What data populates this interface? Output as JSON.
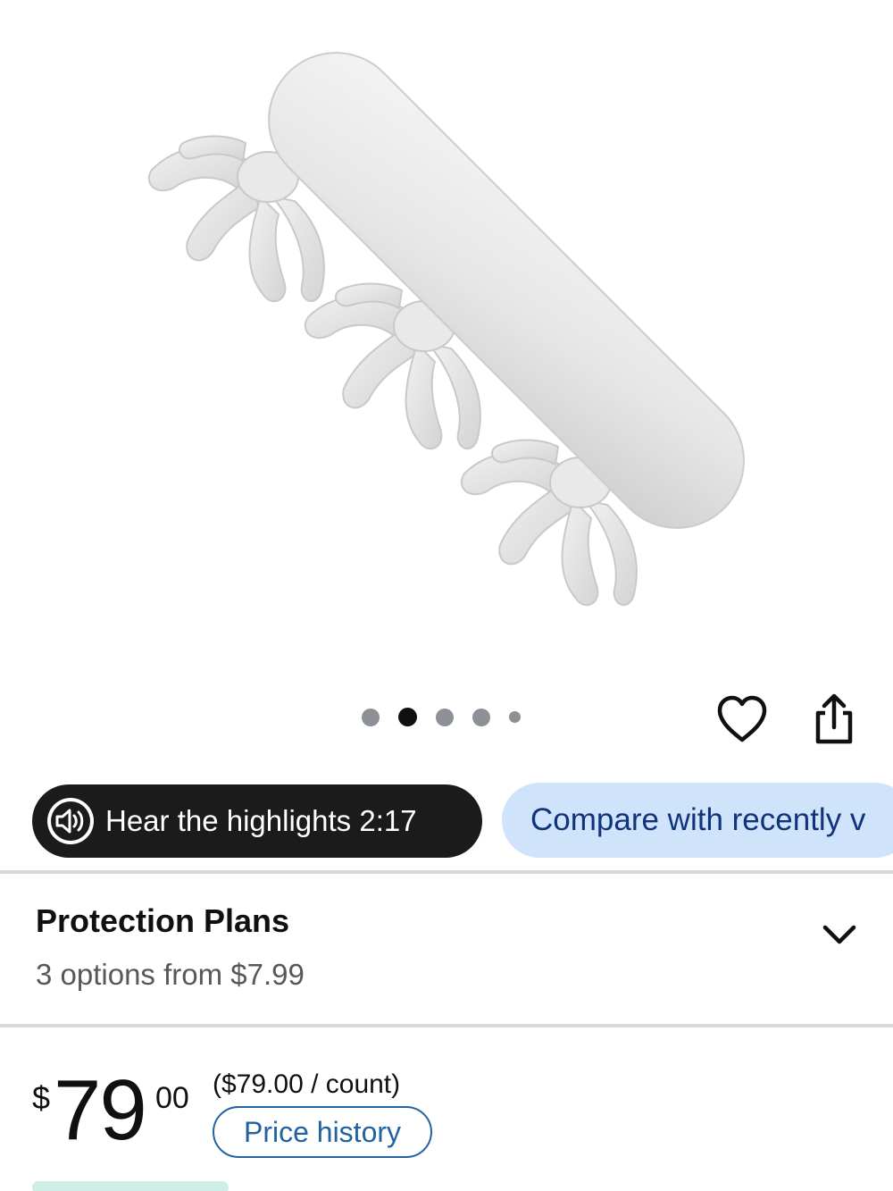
{
  "product": {
    "image_alt": "",
    "carousel": {
      "count": 5,
      "active_index": 1
    }
  },
  "actions": {
    "wishlist_icon": "heart-outline-icon",
    "share_icon": "share-upload-icon"
  },
  "highlights": {
    "label": "Hear the highlights 2:17",
    "icon": "speaker-icon"
  },
  "compare": {
    "label": "Compare with recently v"
  },
  "protection_plans": {
    "title": "Protection Plans",
    "subtitle": "3 options from $7.99",
    "icon": "chevron-down-icon"
  },
  "price": {
    "symbol": "$",
    "whole": "79",
    "fraction": "00",
    "unit_price": "($79.00 / count)",
    "history_label": "Price history"
  },
  "colors": {
    "pill_dark": "#1b1b1b",
    "pill_blue": "#cfe3fb",
    "link_blue": "#2162a1",
    "text_dark": "#0f1111",
    "text_muted": "#565959"
  }
}
